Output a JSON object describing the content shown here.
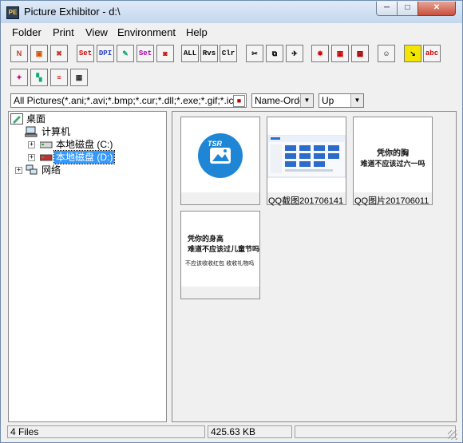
{
  "window": {
    "title": "Picture Exhibitor - d:\\",
    "app_icon_letters": "PE",
    "controls": {
      "minimize": "─",
      "maximize": "□",
      "close": "✕"
    }
  },
  "menu": [
    "Folder",
    "Print",
    "View",
    "Environment",
    "Help"
  ],
  "toolbar": {
    "row1": [
      {
        "name": "new-folder-icon",
        "glyph": "N",
        "color": "#c0392b"
      },
      {
        "name": "open-folder-icon",
        "glyph": "▣",
        "color": "#d35400"
      },
      {
        "name": "close-folder-icon",
        "glyph": "✖",
        "color": "#c0392b"
      },
      {
        "name": "set-printer-icon",
        "glyph": "Set",
        "color": "#c00"
      },
      {
        "name": "dpi-icon",
        "glyph": "DPI",
        "color": "#2040c0"
      },
      {
        "name": "paste-icon",
        "glyph": "✎",
        "color": "#0a7"
      },
      {
        "name": "set-palette-icon",
        "glyph": "Set",
        "color": "#a0a"
      },
      {
        "name": "camera-icon",
        "glyph": "◙",
        "color": "#c00"
      },
      {
        "name": "select-all-button",
        "glyph": "ALL",
        "color": "#000"
      },
      {
        "name": "reverse-selection-button",
        "glyph": "Rvs",
        "color": "#000"
      },
      {
        "name": "clear-selection-button",
        "glyph": "Clr",
        "color": "#000"
      },
      {
        "name": "cut-icon",
        "glyph": "✂",
        "color": "#000"
      },
      {
        "name": "copy-icon",
        "glyph": "⧉",
        "color": "#000"
      },
      {
        "name": "move-icon",
        "glyph": "✈",
        "color": "#000"
      },
      {
        "name": "burst-icon",
        "glyph": "✸",
        "color": "#d00"
      },
      {
        "name": "frame-icon",
        "glyph": "▦",
        "color": "#c00"
      },
      {
        "name": "brick-icon",
        "glyph": "▩",
        "color": "#a00"
      },
      {
        "name": "face-icon",
        "glyph": "☺",
        "color": "#000"
      },
      {
        "name": "arrow-down-icon",
        "glyph": "↘",
        "color": "#000",
        "bg": "#f2e600"
      },
      {
        "name": "abc123-icon",
        "glyph": "abc",
        "color": "#c00"
      }
    ],
    "row2": [
      {
        "name": "slideshow-icon",
        "glyph": "✦",
        "color": "#c07"
      },
      {
        "name": "color-swatch-icon",
        "glyph": "▚",
        "color": "#1a7"
      },
      {
        "name": "layers-icon",
        "glyph": "≡",
        "color": "#c00"
      },
      {
        "name": "grid-icon",
        "glyph": "▦",
        "color": "#333"
      }
    ]
  },
  "filters": {
    "file_types": "All Pictures(*.ani;*.avi;*.bmp;*.cur;*.dll;*.exe;*.gif;*.ico;*.jpe;",
    "sort_order": "Name-Order",
    "direction": "Up"
  },
  "tree": {
    "desktop": "桌面",
    "computer": "计算机",
    "drive_c": "本地磁盘 (C:)",
    "drive_d": "本地磁盘 (D:)",
    "network": "网络"
  },
  "thumbnails": [
    {
      "caption": "",
      "kind": "app-logo",
      "logo_text": "TSR"
    },
    {
      "caption": "QQ截图201706141",
      "kind": "screenshot"
    },
    {
      "caption": "QQ图片201706011",
      "kind": "text",
      "lines": [
        "凭你的胸",
        "难道不应该过六一吗"
      ]
    },
    {
      "caption": "",
      "kind": "text",
      "lines": [
        "凭你的身高",
        "难道不应该过儿童节吗",
        "",
        "不应该收收红包 收收礼物吗"
      ]
    }
  ],
  "status": {
    "file_count": "4 Files",
    "total_size": "425.63 KB",
    "extra": ""
  }
}
